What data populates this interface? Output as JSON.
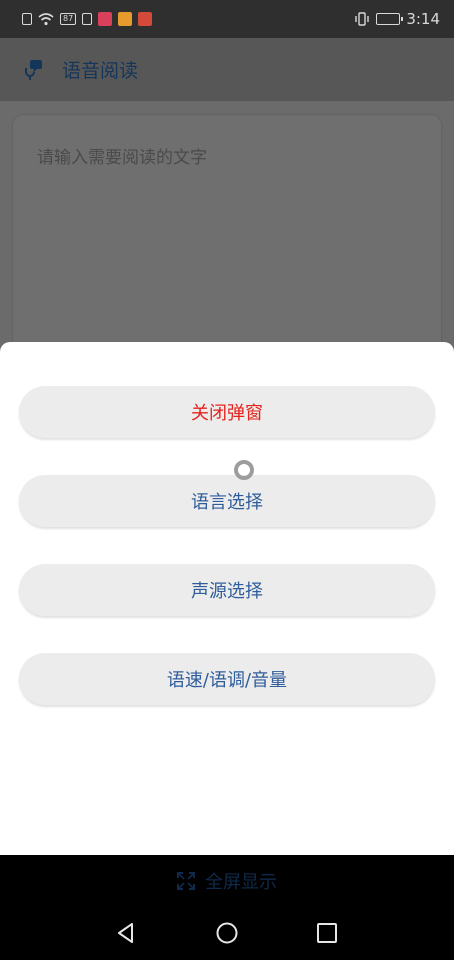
{
  "status_bar": {
    "time": "3:14",
    "net_speed": "87"
  },
  "app_bar": {
    "title": "语音阅读"
  },
  "editor": {
    "placeholder": "请输入需要阅读的文字"
  },
  "sheet": {
    "close_label": "关闭弹窗",
    "language_label": "语言选择",
    "voice_label": "声源选择",
    "speed_label": "语速/语调/音量"
  },
  "bottom": {
    "fullscreen_label": "全屏显示"
  },
  "colors": {
    "accent_red": "#e4231d",
    "accent_blue": "#2f5d9b"
  }
}
